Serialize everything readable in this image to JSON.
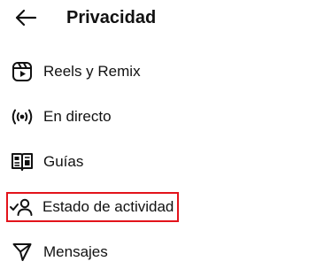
{
  "header": {
    "title": "Privacidad",
    "back_icon": "arrow-left-icon"
  },
  "menu": [
    {
      "label": "Reels y Remix",
      "icon": "reels-icon"
    },
    {
      "label": "En directo",
      "icon": "live-broadcast-icon"
    },
    {
      "label": "Guías",
      "icon": "guides-book-icon"
    },
    {
      "label": "Estado de actividad",
      "icon": "activity-status-icon",
      "highlighted": true
    },
    {
      "label": "Mensajes",
      "icon": "send-message-icon"
    }
  ],
  "colors": {
    "highlight": "#e3131b",
    "text": "#111111",
    "background": "#ffffff"
  }
}
